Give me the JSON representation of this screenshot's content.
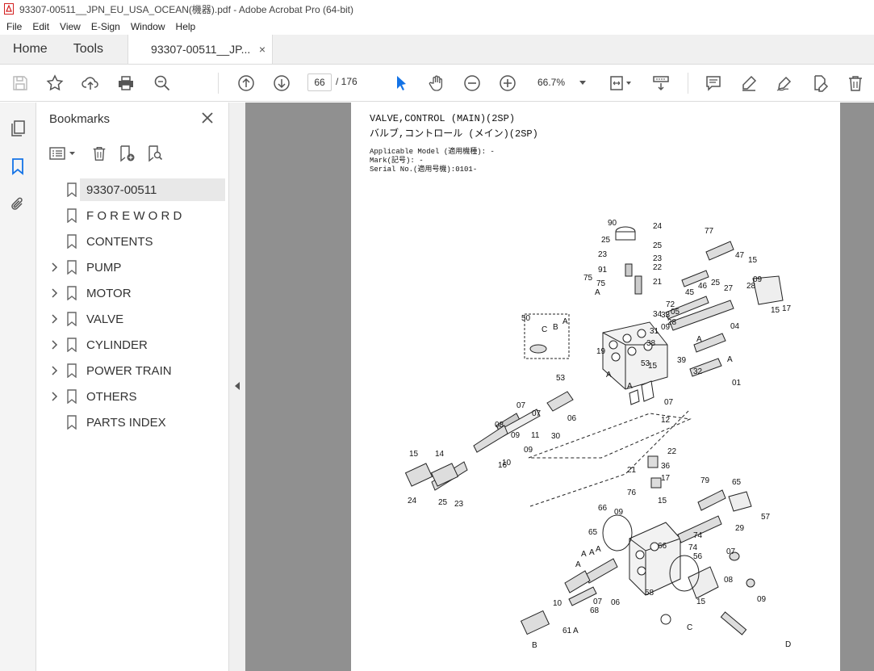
{
  "window": {
    "title": "93307-00511__JPN_EU_USA_OCEAN(機器).pdf - Adobe Acrobat Pro (64-bit)"
  },
  "menu": [
    "File",
    "Edit",
    "View",
    "E-Sign",
    "Window",
    "Help"
  ],
  "tabs": {
    "home": "Home",
    "tools": "Tools",
    "document": "93307-00511__JP...",
    "close": "×"
  },
  "toolbar": {
    "page_current": "66",
    "page_total": "/  176",
    "zoom": "66.7%"
  },
  "bookmarks": {
    "title": "Bookmarks",
    "items": [
      {
        "label": "93307-00511",
        "expandable": false,
        "selected": true
      },
      {
        "label": "F O R E W O R D",
        "expandable": false
      },
      {
        "label": "CONTENTS",
        "expandable": false
      },
      {
        "label": "PUMP",
        "expandable": true
      },
      {
        "label": "MOTOR",
        "expandable": true
      },
      {
        "label": "VALVE",
        "expandable": true
      },
      {
        "label": "CYLINDER",
        "expandable": true
      },
      {
        "label": "POWER TRAIN",
        "expandable": true
      },
      {
        "label": "OTHERS",
        "expandable": true
      },
      {
        "label": "PARTS INDEX",
        "expandable": false
      }
    ]
  },
  "document": {
    "title_en": "VALVE,CONTROL (MAIN)(2SP)",
    "title_jp": "バルブ,コントロール (メイン)(2SP)",
    "applicable_model": "Applicable Model (適用機種): -",
    "mark": "Mark(記号): -",
    "serial": "Serial No.(適用号機):0101-",
    "callouts": [
      "90",
      "24",
      "25",
      "25",
      "23",
      "23",
      "91",
      "22",
      "21",
      "77",
      "47",
      "15",
      "75",
      "75",
      "46",
      "45",
      "25",
      "27",
      "09",
      "72",
      "05",
      "28",
      "28",
      "15",
      "17",
      "04",
      "50",
      "C",
      "B",
      "A",
      "A",
      "A",
      "A",
      "39",
      "32",
      "31",
      "34",
      "33",
      "09",
      "38",
      "19",
      "15",
      "01",
      "A",
      "A",
      "53",
      "53",
      "07",
      "12",
      "07",
      "07",
      "08",
      "30",
      "11",
      "09",
      "06",
      "09",
      "16",
      "14",
      "10",
      "15",
      "24",
      "25",
      "23",
      "22",
      "21",
      "36",
      "17",
      "76",
      "79",
      "65",
      "15",
      "09",
      "66",
      "57",
      "29",
      "65",
      "74",
      "66",
      "74",
      "56",
      "07",
      "08",
      "58",
      "15",
      "06",
      "07",
      "09",
      "10",
      "61",
      "68",
      "A",
      "B",
      "C",
      "D",
      "A",
      "A",
      "A",
      "A"
    ]
  },
  "colors": {
    "accent": "#1473e6",
    "pdf_red": "#d32020",
    "viewer_bg": "#909090"
  }
}
